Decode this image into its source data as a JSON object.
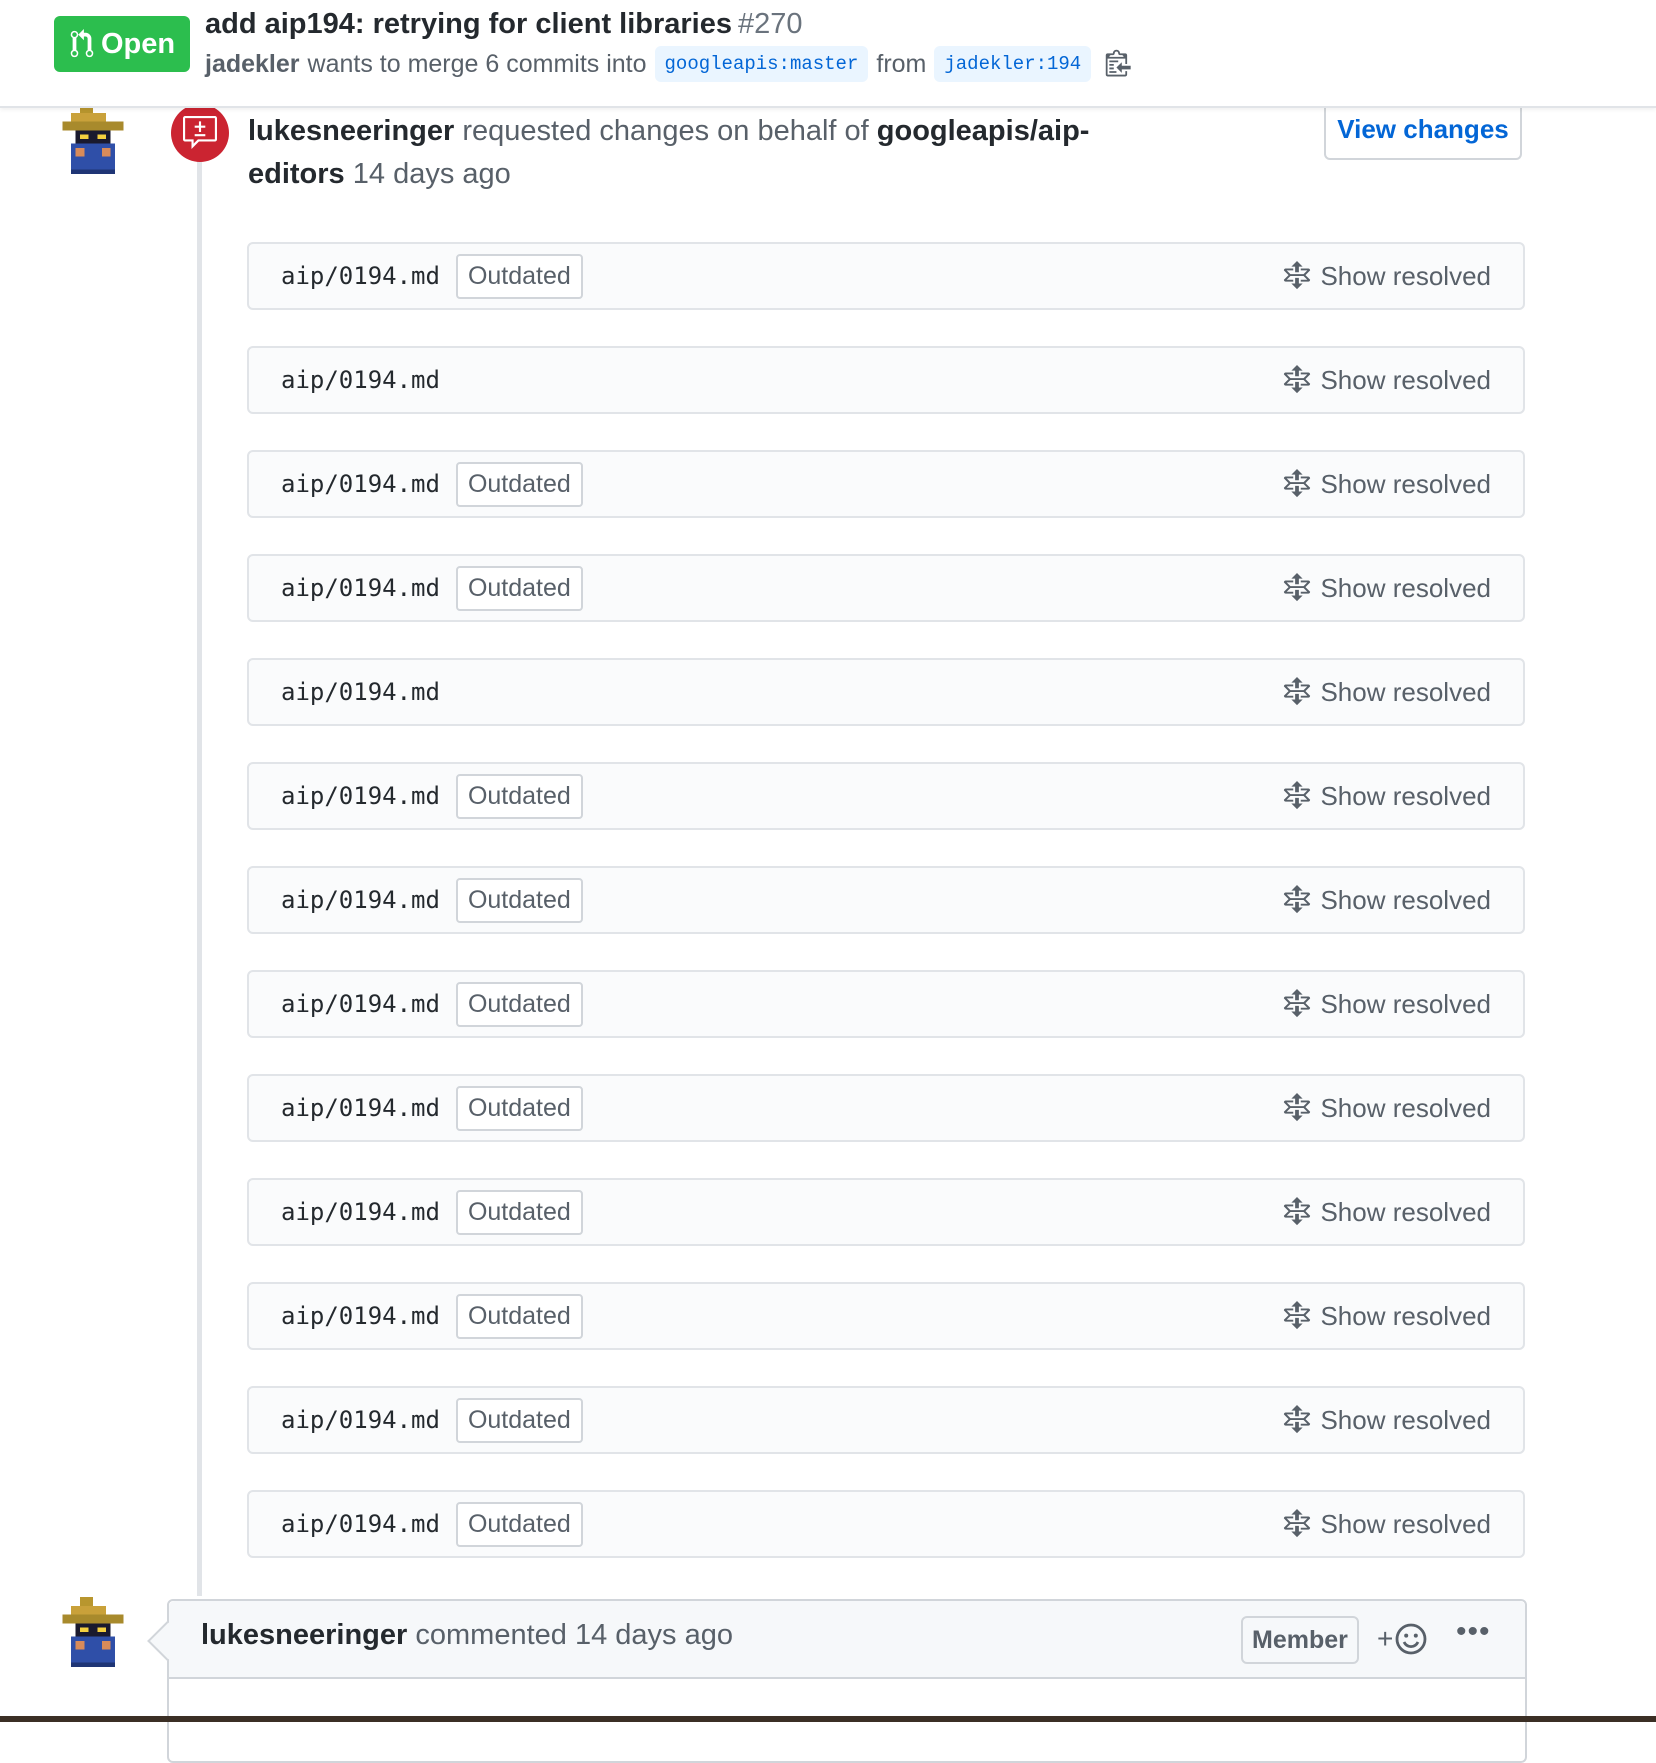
{
  "pr": {
    "state": "Open",
    "title": "add aip194: retrying for client libraries",
    "number": "#270",
    "author": "jadekler",
    "merge_text": "wants to merge 6 commits into",
    "base_branch": "googleapis:master",
    "from_text": "from",
    "head_branch": "jadekler:194"
  },
  "review": {
    "reviewer": "lukesneeringer",
    "action": "requested changes on behalf of",
    "team": "googleapis/aip-editors",
    "time": "14 days ago",
    "view_changes_label": "View changes",
    "threads": [
      {
        "path": "aip/0194.md",
        "outdated": "Outdated",
        "toggle": "Show resolved"
      },
      {
        "path": "aip/0194.md",
        "outdated": "",
        "toggle": "Show resolved"
      },
      {
        "path": "aip/0194.md",
        "outdated": "Outdated",
        "toggle": "Show resolved"
      },
      {
        "path": "aip/0194.md",
        "outdated": "Outdated",
        "toggle": "Show resolved"
      },
      {
        "path": "aip/0194.md",
        "outdated": "",
        "toggle": "Show resolved"
      },
      {
        "path": "aip/0194.md",
        "outdated": "Outdated",
        "toggle": "Show resolved"
      },
      {
        "path": "aip/0194.md",
        "outdated": "Outdated",
        "toggle": "Show resolved"
      },
      {
        "path": "aip/0194.md",
        "outdated": "Outdated",
        "toggle": "Show resolved"
      },
      {
        "path": "aip/0194.md",
        "outdated": "Outdated",
        "toggle": "Show resolved"
      },
      {
        "path": "aip/0194.md",
        "outdated": "Outdated",
        "toggle": "Show resolved"
      },
      {
        "path": "aip/0194.md",
        "outdated": "Outdated",
        "toggle": "Show resolved"
      },
      {
        "path": "aip/0194.md",
        "outdated": "Outdated",
        "toggle": "Show resolved"
      },
      {
        "path": "aip/0194.md",
        "outdated": "Outdated",
        "toggle": "Show resolved"
      }
    ]
  },
  "comment": {
    "author": "lukesneeringer",
    "action": "commented",
    "time": "14 days ago",
    "role_label": "Member",
    "reaction_plus": "+",
    "more_label": "•••"
  },
  "icons": {
    "state": "git-pull-request-icon",
    "copy": "clipboard-copy-icon",
    "review": "request-changes-icon",
    "unfold": "unfold-icon",
    "reaction": "smiley-icon",
    "more": "kebab-horizontal-icon"
  },
  "colors": {
    "open_green": "#2cbe4e",
    "changes_requested_red": "#cb2431",
    "link_blue": "#0366d6"
  }
}
